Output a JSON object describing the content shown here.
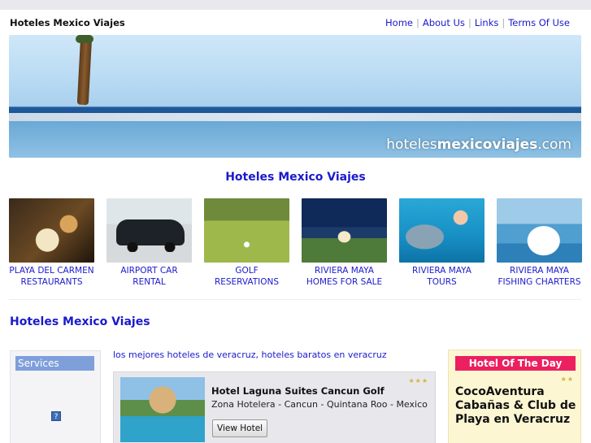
{
  "header": {
    "site_name": "Hoteles Mexico Viajes",
    "nav": [
      "Home",
      "About Us",
      "Links",
      "Terms Of Use"
    ]
  },
  "banner": {
    "brand_plain": "hoteles",
    "brand_bold": "mexicoviajes",
    "brand_tld": ".com"
  },
  "main_title": "Hoteles Mexico Viajes",
  "thumbnails": [
    {
      "caption_line1": "PLAYA DEL CARMEN",
      "caption_line2": "RESTAURANTS"
    },
    {
      "caption_line1": "AIRPORT CAR",
      "caption_line2": "RENTAL"
    },
    {
      "caption_line1": "GOLF",
      "caption_line2": "RESERVATIONS"
    },
    {
      "caption_line1": "RIVIERA MAYA",
      "caption_line2": "HOMES FOR SALE"
    },
    {
      "caption_line1": "RIVIERA MAYA",
      "caption_line2": "TOURS"
    },
    {
      "caption_line1": "RIVIERA MAYA",
      "caption_line2": "FISHING CHARTERS"
    }
  ],
  "section_title": "Hoteles Mexico Viajes",
  "services": {
    "label": "Services",
    "help_icon": "?"
  },
  "intro_link": "los mejores hoteles de veracruz, hoteles baratos en veracruz",
  "hotel": {
    "name": "Hotel Laguna Suites Cancun Golf",
    "stars": "★★★",
    "location": "Zona Hotelera - Cancun - Quintana Roo - Mexico",
    "button": "View Hotel"
  },
  "hotel_of_day": {
    "label": "Hotel Of The Day",
    "stars": "★★",
    "title": "CocoAventura Cabañas & Club de Playa en Veracruz"
  }
}
